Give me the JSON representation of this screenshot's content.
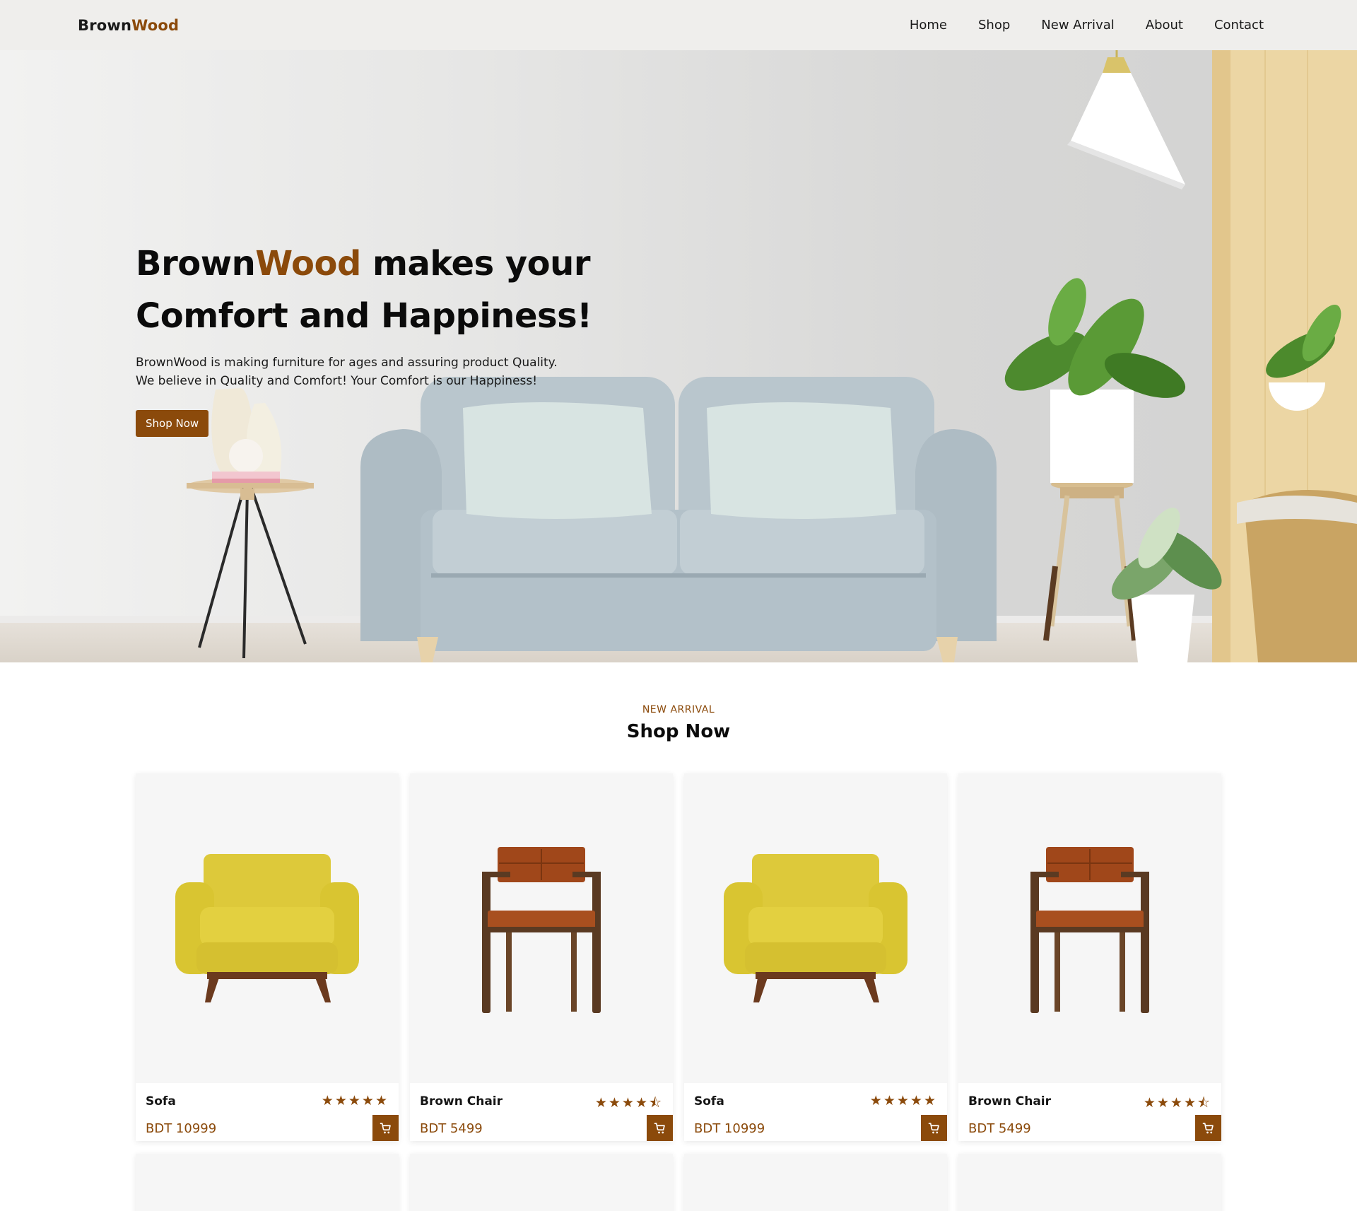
{
  "brand": {
    "part1": "Brown",
    "part2": "Wood"
  },
  "nav": {
    "items": [
      {
        "label": "Home"
      },
      {
        "label": "Shop"
      },
      {
        "label": "New Arrival"
      },
      {
        "label": "About"
      },
      {
        "label": "Contact"
      }
    ]
  },
  "hero": {
    "title_brand1": "Brown",
    "title_brand2": "Wood",
    "title_rest1": " makes your",
    "title_line2": "Comfort and Happiness!",
    "desc_line1": "BrownWood is making furniture for ages and assuring product Quality.",
    "desc_line2": "We believe in Quality and Comfort! Your Comfort is our Happiness!",
    "cta_label": "Shop Now"
  },
  "section": {
    "eyebrow": "NEW ARRIVAL",
    "title": "Shop Now"
  },
  "products": [
    {
      "name": "Sofa",
      "price": "BDT 10999",
      "rating": 5,
      "image": "yellow-armchair"
    },
    {
      "name": "Brown Chair",
      "price": "BDT 5499",
      "rating": 4.5,
      "image": "brown-chair"
    },
    {
      "name": "Sofa",
      "price": "BDT 10999",
      "rating": 5,
      "image": "yellow-armchair"
    },
    {
      "name": "Brown Chair",
      "price": "BDT 5499",
      "rating": 4.5,
      "image": "brown-chair"
    }
  ],
  "colors": {
    "accent": "#8b4a0b",
    "nav_bg": "#efeeec",
    "card_image_bg": "#f6f6f6"
  },
  "icons": {
    "cart": "shopping-cart-icon",
    "star": "star-icon",
    "half_star": "half-star-icon"
  }
}
